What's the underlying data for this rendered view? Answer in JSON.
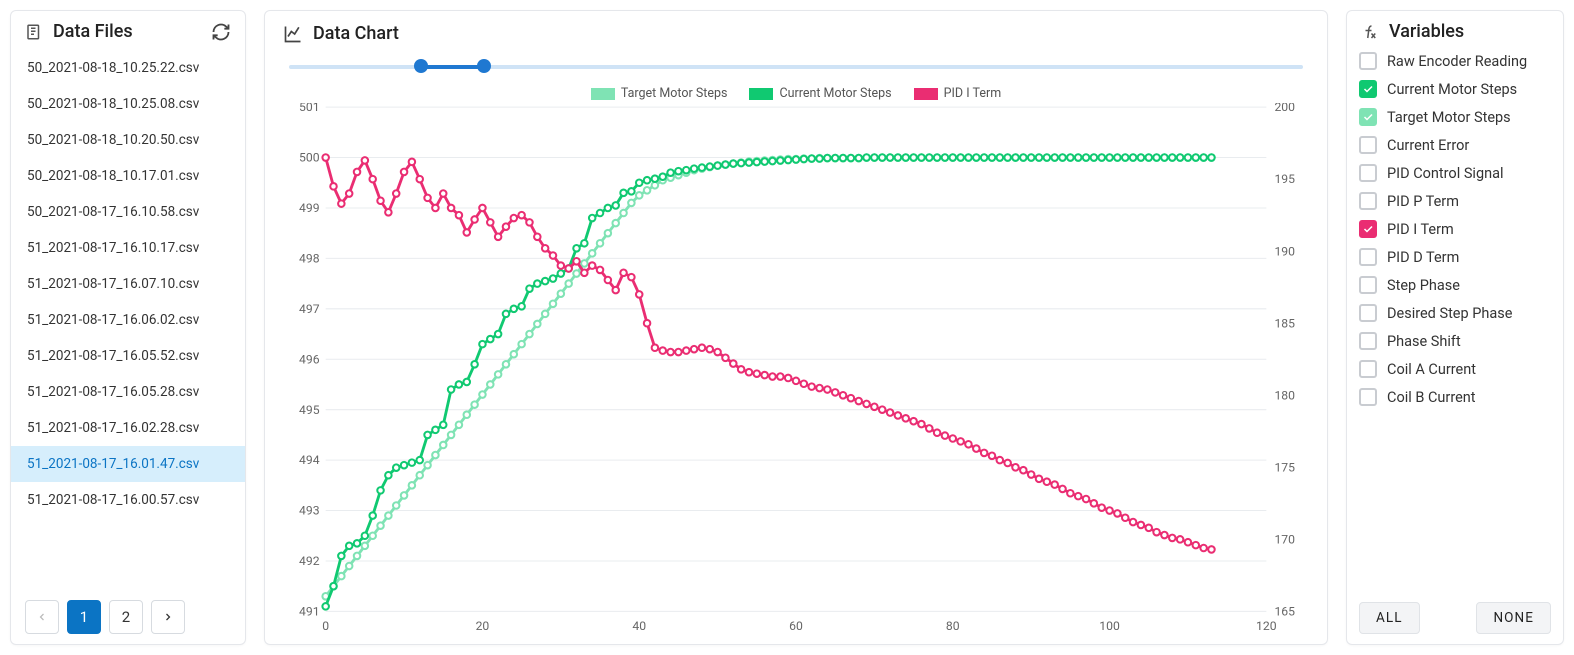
{
  "accent_primary": "#0b74c4",
  "sidebar": {
    "title": "Data Files",
    "files": [
      "50_2021-08-18_10.25.22.csv",
      "50_2021-08-18_10.25.08.csv",
      "50_2021-08-18_10.20.50.csv",
      "50_2021-08-18_10.17.01.csv",
      "50_2021-08-17_16.10.58.csv",
      "51_2021-08-17_16.10.17.csv",
      "51_2021-08-17_16.07.10.csv",
      "51_2021-08-17_16.06.02.csv",
      "51_2021-08-17_16.05.52.csv",
      "51_2021-08-17_16.05.28.csv",
      "51_2021-08-17_16.02.28.csv",
      "51_2021-08-17_16.01.47.csv",
      "51_2021-08-17_16.00.57.csv"
    ],
    "selected_index": 11,
    "pager": {
      "pages": [
        "1",
        "2"
      ],
      "current": 0
    }
  },
  "chart": {
    "title": "Data Chart",
    "legend": [
      "Target Motor Steps",
      "Current Motor Steps",
      "PID I Term"
    ],
    "colors": {
      "target": "#7fe3b4",
      "current": "#10c971",
      "pid_i": "#ea2d72"
    },
    "slider": {
      "from_pct": 13.0,
      "to_pct": 19.2
    }
  },
  "chart_data": {
    "type": "line",
    "title": "Data Chart",
    "xlabel": "",
    "ylabel_left": "",
    "ylabel_right": "",
    "xlim": [
      0,
      120
    ],
    "ylim_left": [
      491,
      501
    ],
    "ylim_right": [
      165,
      200
    ],
    "x_ticks": [
      0,
      20,
      40,
      60,
      80,
      100,
      120
    ],
    "y_ticks_left": [
      491,
      492,
      493,
      494,
      495,
      496,
      497,
      498,
      499,
      500,
      501
    ],
    "y_ticks_right": [
      165,
      170,
      175,
      180,
      185,
      190,
      195,
      200
    ],
    "x": [
      0,
      1,
      2,
      3,
      4,
      5,
      6,
      7,
      8,
      9,
      10,
      11,
      12,
      13,
      14,
      15,
      16,
      17,
      18,
      19,
      20,
      21,
      22,
      23,
      24,
      25,
      26,
      27,
      28,
      29,
      30,
      31,
      32,
      33,
      34,
      35,
      36,
      37,
      38,
      39,
      40,
      41,
      42,
      43,
      44,
      45,
      46,
      47,
      48,
      49,
      50,
      51,
      52,
      53,
      54,
      55,
      56,
      57,
      58,
      59,
      60,
      61,
      62,
      63,
      64,
      65,
      66,
      67,
      68,
      69,
      70,
      71,
      72,
      73,
      74,
      75,
      76,
      77,
      78,
      79,
      80,
      81,
      82,
      83,
      84,
      85,
      86,
      87,
      88,
      89,
      90,
      91,
      92,
      93,
      94,
      95,
      96,
      97,
      98,
      99,
      100,
      101,
      102,
      103,
      104,
      105,
      106,
      107,
      108,
      109,
      110,
      111,
      112,
      113
    ],
    "series": [
      {
        "name": "Target Motor Steps",
        "axis": "left",
        "color": "#7fe3b4",
        "values": [
          491.3,
          491.5,
          491.7,
          491.9,
          492.1,
          492.3,
          492.5,
          492.7,
          492.9,
          493.1,
          493.3,
          493.5,
          493.7,
          493.9,
          494.1,
          494.3,
          494.5,
          494.7,
          494.9,
          495.1,
          495.3,
          495.5,
          495.7,
          495.9,
          496.1,
          496.3,
          496.5,
          496.7,
          496.9,
          497.1,
          497.3,
          497.5,
          497.7,
          497.9,
          498.1,
          498.3,
          498.5,
          498.7,
          498.9,
          499.1,
          499.25,
          499.35,
          499.45,
          499.55,
          499.6,
          499.65,
          499.7,
          499.75,
          499.78,
          499.81,
          499.84,
          499.86,
          499.88,
          499.9,
          499.92,
          499.93,
          499.94,
          499.95,
          499.96,
          499.97,
          499.97,
          499.98,
          499.98,
          499.99,
          499.99,
          499.99,
          499.99,
          499.99,
          499.99,
          500.0,
          500.0,
          500.0,
          500.0,
          500.0,
          500.0,
          500.0,
          500.0,
          500.0,
          500.0,
          500.0,
          500.0,
          500.0,
          500.0,
          500.0,
          500.0,
          500.0,
          500.0,
          500.0,
          500.0,
          500.0,
          500.0,
          500.0,
          500.0,
          500.0,
          500.0,
          500.0,
          500.0,
          500.0,
          500.0,
          500.0,
          500.0,
          500.0,
          500.0,
          500.0,
          500.0,
          500.0,
          500.0,
          500.0,
          500.0,
          500.0,
          500.0,
          500.0,
          500.0,
          500.0
        ]
      },
      {
        "name": "Current Motor Steps",
        "axis": "left",
        "color": "#10c971",
        "values": [
          491.1,
          491.5,
          492.1,
          492.3,
          492.35,
          492.5,
          492.9,
          493.4,
          493.7,
          493.85,
          493.9,
          493.95,
          494.0,
          494.5,
          494.6,
          494.7,
          495.4,
          495.5,
          495.55,
          495.9,
          496.3,
          496.4,
          496.5,
          496.9,
          497.0,
          497.05,
          497.4,
          497.5,
          497.55,
          497.6,
          497.7,
          497.8,
          498.2,
          498.3,
          498.8,
          498.9,
          499.0,
          499.05,
          499.3,
          499.33,
          499.5,
          499.55,
          499.58,
          499.62,
          499.7,
          499.73,
          499.75,
          499.78,
          499.8,
          499.82,
          499.84,
          499.86,
          499.88,
          499.89,
          499.9,
          499.91,
          499.92,
          499.93,
          499.94,
          499.95,
          499.96,
          499.97,
          499.98,
          499.98,
          499.99,
          499.99,
          499.99,
          499.99,
          499.99,
          500.0,
          500.0,
          500.0,
          500.0,
          500.0,
          500.0,
          500.0,
          500.0,
          500.0,
          500.0,
          500.0,
          500.0,
          500.0,
          500.0,
          500.0,
          500.0,
          500.0,
          500.0,
          500.0,
          500.0,
          500.0,
          500.0,
          500.0,
          500.0,
          500.0,
          500.0,
          500.0,
          500.0,
          500.0,
          500.0,
          500.0,
          500.0,
          500.0,
          500.0,
          500.0,
          500.0,
          500.0,
          500.0,
          500.0,
          500.0,
          500.0,
          500.0,
          500.0,
          500.0,
          500.0
        ]
      },
      {
        "name": "PID I Term",
        "axis": "right",
        "color": "#ea2d72",
        "values": [
          196.5,
          194.5,
          193.3,
          194.0,
          195.5,
          196.3,
          195.0,
          193.5,
          192.7,
          194.0,
          195.5,
          196.2,
          195.0,
          193.7,
          193.0,
          194.0,
          193.0,
          192.5,
          191.3,
          192.2,
          193.0,
          192.0,
          191.0,
          191.7,
          192.3,
          192.5,
          192.0,
          191.0,
          190.2,
          189.7,
          189.0,
          188.8,
          189.3,
          188.5,
          189.0,
          188.7,
          188.0,
          187.3,
          188.5,
          188.2,
          187.0,
          185.0,
          183.3,
          183.1,
          183.0,
          183.0,
          183.1,
          183.2,
          183.3,
          183.2,
          183.0,
          182.6,
          182.2,
          181.8,
          181.6,
          181.5,
          181.4,
          181.3,
          181.3,
          181.2,
          181.0,
          180.8,
          180.6,
          180.5,
          180.4,
          180.2,
          180.0,
          179.8,
          179.6,
          179.4,
          179.2,
          179.0,
          178.8,
          178.6,
          178.4,
          178.2,
          178.0,
          177.7,
          177.4,
          177.2,
          177.0,
          176.8,
          176.6,
          176.3,
          176.0,
          175.8,
          175.5,
          175.3,
          175.0,
          174.8,
          174.5,
          174.2,
          174.0,
          173.8,
          173.5,
          173.2,
          173.0,
          172.8,
          172.5,
          172.2,
          172.0,
          171.8,
          171.5,
          171.2,
          171.0,
          170.8,
          170.5,
          170.3,
          170.1,
          170.0,
          169.8,
          169.6,
          169.4,
          169.3
        ]
      }
    ]
  },
  "variables": {
    "title": "Variables",
    "items": [
      {
        "label": "Raw Encoder Reading",
        "checked": false
      },
      {
        "label": "Current Motor Steps",
        "checked": true,
        "color": "green"
      },
      {
        "label": "Target Motor Steps",
        "checked": true,
        "color": "lgreen"
      },
      {
        "label": "Current Error",
        "checked": false
      },
      {
        "label": "PID Control Signal",
        "checked": false
      },
      {
        "label": "PID P Term",
        "checked": false
      },
      {
        "label": "PID I Term",
        "checked": true,
        "color": "pink"
      },
      {
        "label": "PID D Term",
        "checked": false
      },
      {
        "label": "Step Phase",
        "checked": false
      },
      {
        "label": "Desired Step Phase",
        "checked": false
      },
      {
        "label": "Phase Shift",
        "checked": false
      },
      {
        "label": "Coil A Current",
        "checked": false
      },
      {
        "label": "Coil B Current",
        "checked": false
      }
    ],
    "buttons": {
      "all": "ALL",
      "none": "NONE"
    }
  }
}
